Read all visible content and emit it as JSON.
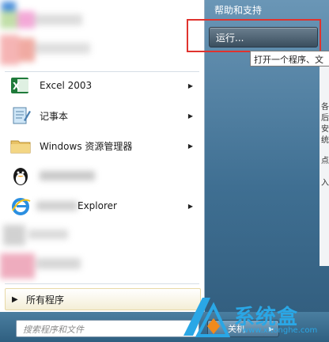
{
  "programs": [
    {
      "label": "Excel 2003",
      "has_submenu": true,
      "icon": "excel-icon"
    },
    {
      "label": "记事本",
      "has_submenu": true,
      "icon": "notepad-icon"
    },
    {
      "label": "Windows 资源管理器",
      "has_submenu": true,
      "icon": "explorer-folder-icon"
    },
    {
      "label": "",
      "has_submenu": false,
      "icon": "qq-penguin-icon"
    },
    {
      "label": "Explorer",
      "has_submenu": true,
      "icon": "internet-explorer-icon"
    }
  ],
  "all_programs": {
    "label": "所有程序"
  },
  "search": {
    "placeholder": "搜索程序和文件"
  },
  "right_pane": {
    "help_label": "帮助和支持",
    "run_label": "运行...",
    "tooltip": "打开一个程序、文"
  },
  "shutdown": {
    "label": "关机"
  },
  "watermark": {
    "title": "系统盒",
    "url": "www.xitonghe.com"
  },
  "colors": {
    "highlight_border": "#e0332e",
    "accent": "#2aa7e6"
  }
}
